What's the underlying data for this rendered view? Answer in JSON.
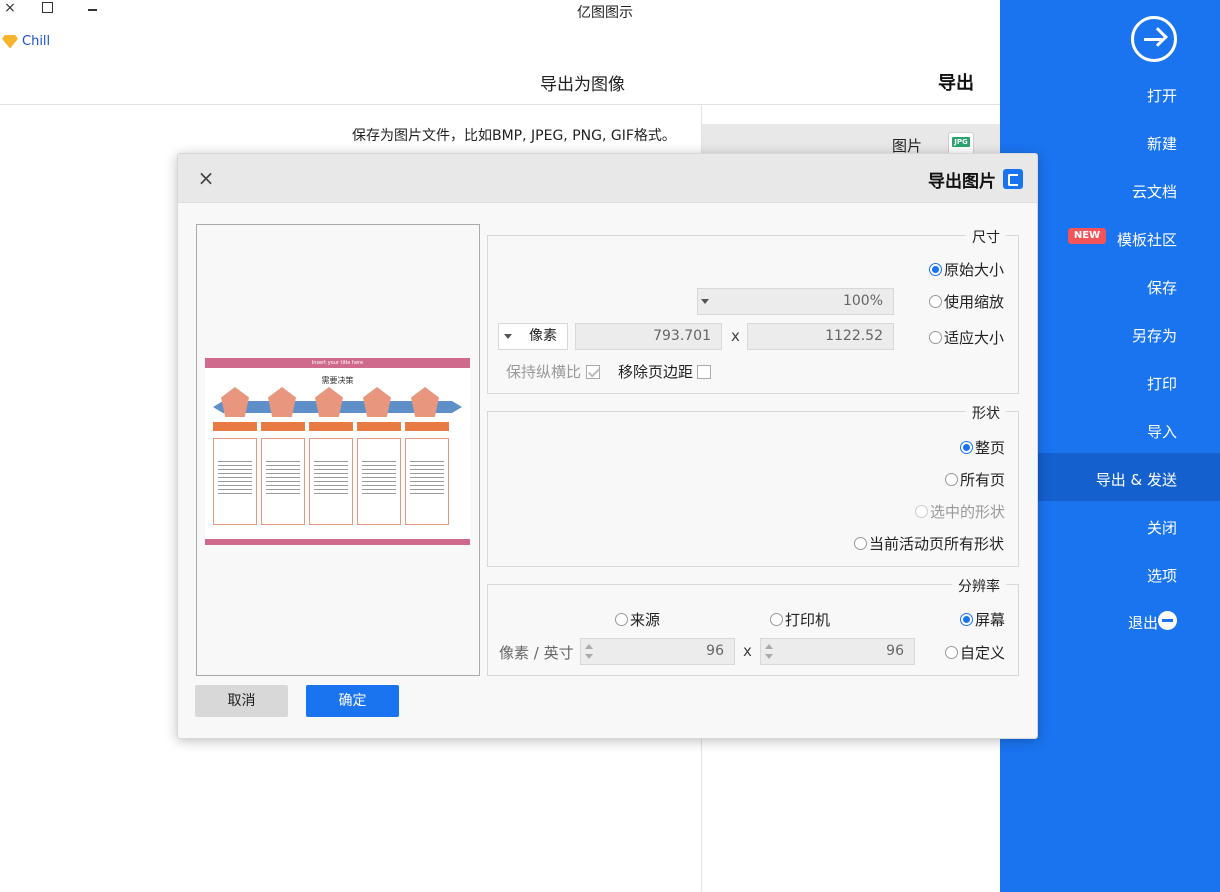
{
  "window": {
    "title": "亿图图示",
    "close_glyph": "×"
  },
  "user": {
    "name": "Chill"
  },
  "panel": {
    "heading": "导出",
    "title": "导出为图像",
    "description": "保存为图片文件，比如BMP, JPEG, PNG, GIF格式。",
    "format_item_label": "图片",
    "format_icon_text": "JPG"
  },
  "sidebar": {
    "items": [
      {
        "label": "打开"
      },
      {
        "label": "新建"
      },
      {
        "label": "云文档"
      },
      {
        "label": "模板社区",
        "badge": "NEW"
      },
      {
        "label": "保存"
      },
      {
        "label": "另存为"
      },
      {
        "label": "打印"
      },
      {
        "label": "导入"
      },
      {
        "label": "导出 & 发送"
      },
      {
        "label": "关闭"
      },
      {
        "label": "选项"
      },
      {
        "label": "退出"
      }
    ],
    "active_item": "导出 & 发送",
    "colors": {
      "background": "#1a74f0",
      "active": "#1560cf"
    }
  },
  "dialog": {
    "title": "导出图片",
    "close_glyph": "×",
    "preview": {
      "banner": "Insert your title here",
      "heading": "需要决策"
    },
    "size": {
      "label": "尺寸",
      "options": [
        "原始大小",
        "使用缩放",
        "适应大小"
      ],
      "selected": "原始大小",
      "zoom_value": "100%",
      "width_value": "1122.52",
      "height_value": "793.701",
      "times": "x",
      "unit": "像素",
      "remove_margin_label": "移除页边距",
      "keep_ratio_label": "保持纵横比"
    },
    "shape": {
      "label": "形状",
      "options": [
        "整页",
        "所有页",
        "选中的形状",
        "当前活动页所有形状"
      ],
      "selected": "整页"
    },
    "resolution": {
      "label": "分辨率",
      "options": [
        "屏幕",
        "打印机",
        "来源",
        "自定义"
      ],
      "selected": "屏幕",
      "x_value": "96",
      "y_value": "96",
      "times": "x",
      "unit": "像素 / 英寸"
    },
    "buttons": {
      "ok": "确定",
      "cancel": "取消"
    }
  }
}
